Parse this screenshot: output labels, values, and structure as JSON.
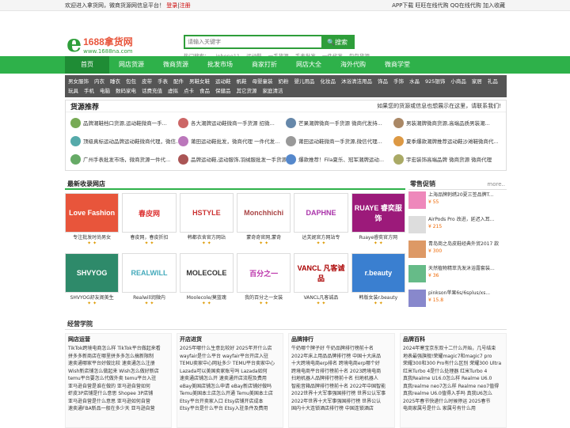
{
  "topbar": {
    "welcome": "欢迎进入拿货网，微商货源网信息平台！",
    "login": "登录",
    "register": "注册",
    "right": "APP下载 旺旺在线代购 QQ在线代购 加入收藏"
  },
  "logo": {
    "e": "e",
    "brand": "1688拿货网",
    "url": "www.1688na.com"
  },
  "search": {
    "placeholder": "请输入关键字",
    "button": "搜索",
    "hot_label": "热门搜索：",
    "hot": [
      "iphone11",
      "运动鞋",
      "一手货源",
      "手表批发",
      "一件代发",
      "包包货源"
    ]
  },
  "nav": [
    "首页",
    "网店货源",
    "微商货源",
    "批发市场",
    "商家打折",
    "网店大全",
    "海外代购",
    "微商学堂"
  ],
  "categories": [
    "男女服饰",
    "内衣",
    "睡衣",
    "包包",
    "皮带",
    "手表",
    "配件",
    "男鞋女鞋",
    "运动鞋",
    "帆鞋",
    "母婴童装",
    "奶粉",
    "婴儿用品",
    "化妆品",
    "沐浴清洁用品",
    "饰品",
    "手饰",
    "水晶",
    "925银饰",
    "小商品",
    "家居",
    "礼品",
    "玩具",
    "手机",
    "电脑",
    "数码家电",
    "话费充值",
    "虚拟",
    "点卡",
    "食品",
    "保健品",
    "其它货源",
    "家庭清洁"
  ],
  "sources": {
    "title": "货源推荐",
    "note": "如果您的货源或信息也想展示在这里，请联系我们!",
    "items": [
      "品牌潮鞋档口货源,运动鞋微商一手...",
      "各大潮牌运动鞋微商一手货源 招微...",
      "芒果潮牌微商一手货源 微商代发持...",
      "男装潮牌微商货源,高端品质男装潮...",
      "顶级真标运动品牌运动鞋微商代理，微信...",
      "莆田运动鞋批发，微商代理 一件代发...",
      "莆田运动鞋微商一手货源,微信代理...",
      "夏季爆款潮牌推荐运动鞋沙滩鞋微商代...",
      "广州手表批发市场，微商货源一件代...",
      "品牌运动鞋,运动服饰,羽绒服批发一手货源...",
      "爆款推荐！Fila夏乐、冠军潮牌运动...",
      "宇宏装饰高端品牌 微商货源 微商代理"
    ]
  },
  "shops": {
    "title": "最新收录网店",
    "items": [
      {
        "name": "专注批发时尚男女",
        "img": "Love Fashion"
      },
      {
        "name": "春皮网，春皮折扣",
        "img": "春皮网"
      },
      {
        "name": "韩都衣舍官方网站",
        "img": "HSTYLE"
      },
      {
        "name": "蒙奇奇官网,蒙奇",
        "img": "Monchhichi"
      },
      {
        "name": "达芙妮官方网站专",
        "img": "DAPHNE"
      },
      {
        "name": "Ruaye睿奕官方网",
        "img": "RUAYE 睿奕服饰"
      },
      {
        "name": "SHVYOG舒友阁美生",
        "img": "SHVYOG"
      },
      {
        "name": "Realwill润微内",
        "img": "REALWILL"
      },
      {
        "name": "Moolecole/莫蓝瑰",
        "img": "MOLECOLE"
      },
      {
        "name": "我的百分之一女装",
        "img": "百分之一"
      },
      {
        "name": "VANCL凡客诚品",
        "img": "VANCL 凡客诚品"
      },
      {
        "name": "韩版女装r.beauty",
        "img": "r.beauty"
      }
    ]
  },
  "promo": {
    "title": "零售促销",
    "more": "more..",
    "items": [
      {
        "name": "上海品牌刺绣20夏三签品牌T...",
        "price": "¥ 55"
      },
      {
        "name": "AirPods Pro 改进，延迟入耳...",
        "price": "¥ 215"
      },
      {
        "name": "青岛商之岛皮鞋经典外贸2017 款",
        "price": "¥ 300"
      },
      {
        "name": "天然植物精萃洗发沐浴露套装...",
        "price": "¥ 36"
      },
      {
        "name": "pinkson苹果6s/6splus/xs...",
        "price": "¥ 15.8"
      }
    ]
  },
  "school": {
    "title": "经营学院",
    "columns": [
      {
        "title": "网店运营",
        "items": [
          "TikTok跨境电商怎么样 TikTok平台做起来看",
          "拼多多新商店在哪里拼多多怎么搞新限制",
          "速卖通哪家平台好做比较 速卖通怎么注册",
          "Wish新店铺怎么做起来 Wish怎么做好新店",
          "temu平台要怎么代做外卖 temu平台入驻",
          "亚马逊自营是谁在做的 亚马逊自营如何",
          "虾皮3P店铺是什么意思 Shopee 3P店铺",
          "亚马逊自营是什么意思 亚马逊如何自营",
          "速卖通FBA新品一般在多少天 亚马逊自营"
        ]
      },
      {
        "title": "开店进货",
        "items": [
          "2025年哪什么生意比较好 2025年开什么店",
          "wayfair是什么平台 wayfair平台开店入驻",
          "TEMU卖家中心网址多少 TEMU平台卖家中心",
          "Lazada可以美国卖家账号吗 Lazada如何",
          "速卖通店铺怎么开 速卖通开店流程及费用",
          "eBay美国店铺怎么申请 eBay新店铺好做吗",
          "Temu美国本土店怎么开通 Temu美国本土店",
          "Etsy平台开卖家入口 Etsy店铺开店成本",
          "Etsy平台是什么平台 Etsy入驻条件及费用"
        ]
      },
      {
        "title": "品牌排行",
        "items": [
          "牛奶哪个牌子好 牛奶品牌排行榜前十名",
          "2022年床上用品品牌排行榜 中国十大床品",
          "十大跨境电商erp排名 跨境电商erp哪个好",
          "跨境电商平台排行榜前十名 2023跨境电商",
          "扫地机器人品牌排行榜前十名 扫地机器人",
          "智能音箱品牌排行榜前十名 2022年中国智能",
          "2022世界十大军事强国排行榜 世界公认军事",
          "2022年世界十大军事强国排行榜 世界公认",
          "国内十大连锁酒店排行榜 中国连锁酒店"
        ]
      },
      {
        "title": "品牌百科",
        "items": [
          "2024年寒宝京东双十二什么开始，几号结束",
          "地表最强旗舰!荣耀magic7和magic7 pro",
          "荣耀300和300 Pro有什么区别 荣耀300 Ultra",
          "红米Turbo 4是什么处理器 红米Turbo 4",
          "真我Realme U16.0怎么样 Realme U6.0",
          "真我realme neo7怎么样 Realme neo7值得",
          "真我realme U6.0值得入手吗 真我U6怎么",
          "2025年春节快递什么时候停运 2025春节",
          "电商家属号是什么 家属号有什么用"
        ]
      }
    ]
  }
}
